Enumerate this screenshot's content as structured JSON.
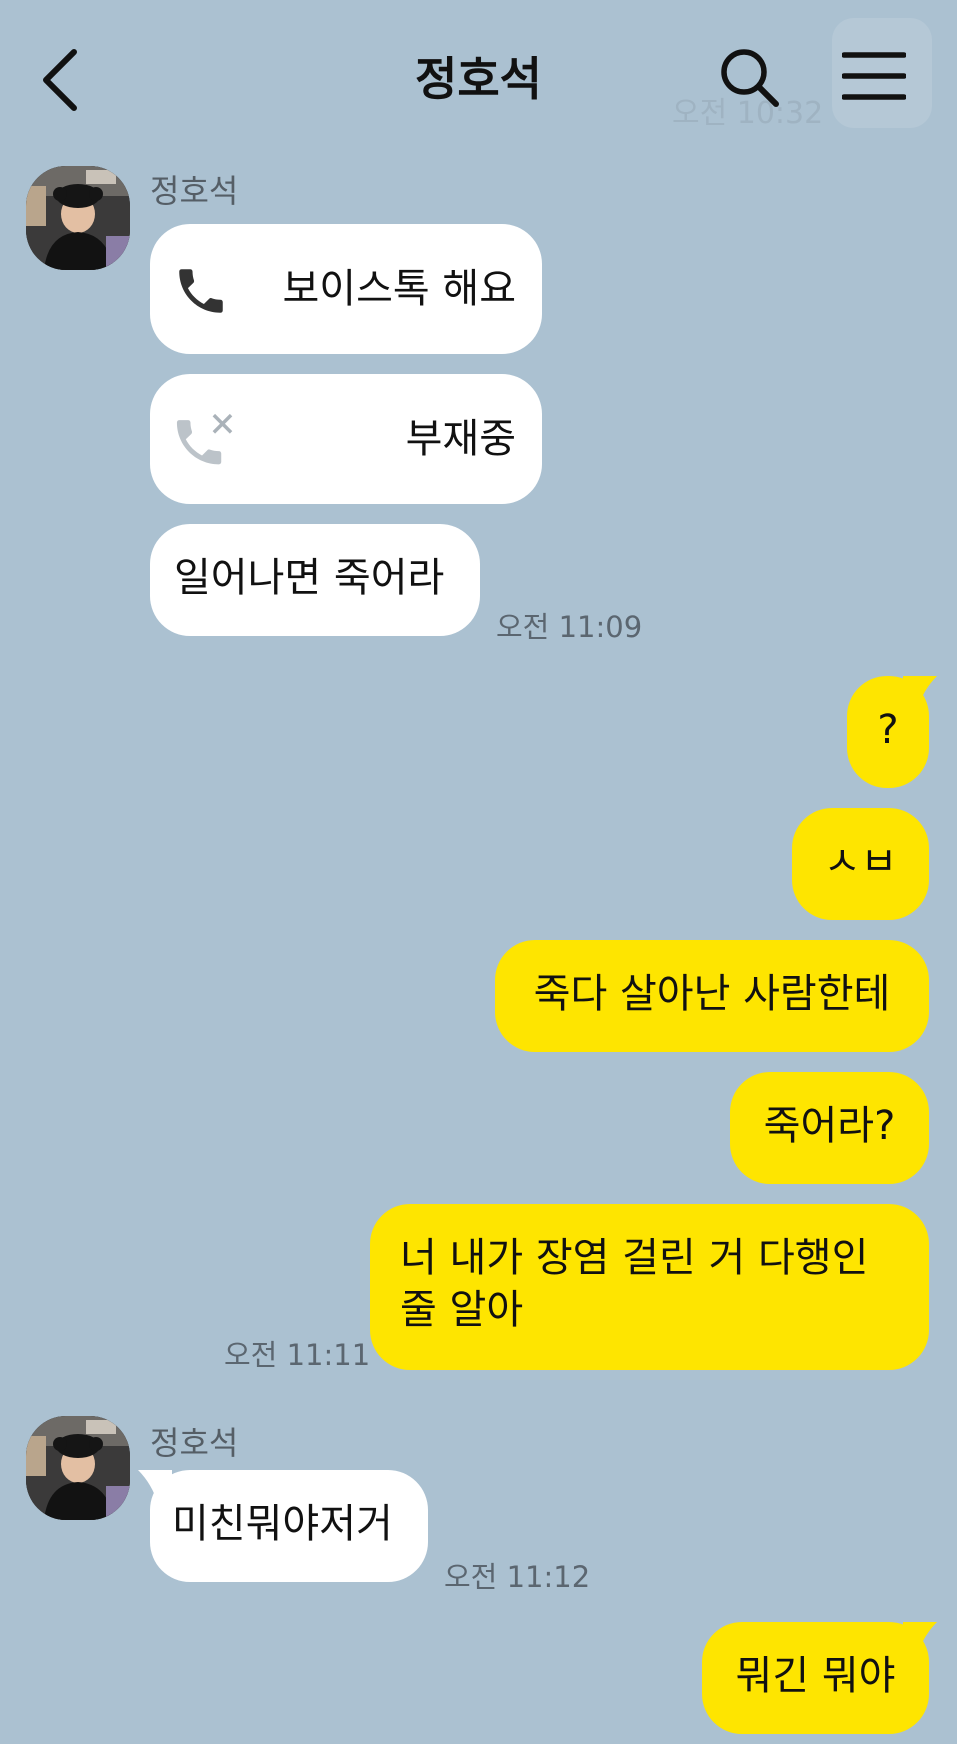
{
  "header": {
    "title": "정호석",
    "ghost_time": "오전 10:32"
  },
  "colors": {
    "background": "#abc1d1",
    "incoming_bubble": "#ffffff",
    "outgoing_bubble": "#fee500",
    "timestamp": "#5b6670"
  },
  "icons": {
    "back": "chevron-left-icon",
    "search": "search-icon",
    "menu": "hamburger-menu-icon",
    "call": "phone-icon",
    "missed_call": "missed-call-icon"
  },
  "messages": {
    "group1": {
      "sender": "정호석",
      "call1": "보이스톡 해요",
      "call2": "부재중",
      "text": "일어나면 죽어라",
      "time": "오전 11:09"
    },
    "out1": "?",
    "out2": "ㅅㅂ",
    "out3": "죽다 살아난 사람한테",
    "out4": "죽어라?",
    "out5_line1": "너 내가 장염 걸린 거 다행인",
    "out5_line2": "줄 알아",
    "out_time": "오전 11:11",
    "group2": {
      "sender": "정호석",
      "text": "미친뭐야저거",
      "time": "오전 11:12"
    },
    "out6": "뭐긴 뭐야"
  }
}
